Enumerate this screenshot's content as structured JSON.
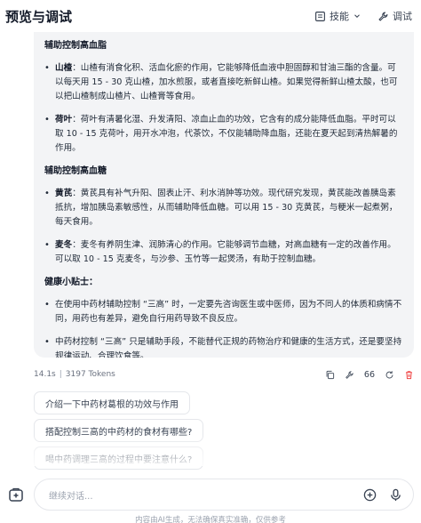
{
  "header": {
    "title": "预览与调试",
    "skills_label": "技能",
    "debug_label": "调试"
  },
  "message": {
    "sections": [
      {
        "title": "辅助控制高血脂",
        "items": [
          {
            "name": "山楂",
            "text": "：山楂有消食化积、活血化瘀的作用，它能够降低血液中胆固醇和甘油三酯的含量。可以每天用 15 - 30 克山楂，加水煎服，或者直接吃新鲜山楂。如果觉得新鲜山楂太酸，也可以把山楂制成山楂片、山楂膏等食用。"
          },
          {
            "name": "荷叶",
            "text": "：荷叶有清暑化湿、升发清阳、凉血止血的功效，它含有的成分能降低血脂。平时可以取 10 - 15 克荷叶，用开水冲泡，代茶饮，不仅能辅助降血脂，还能在夏天起到清热解暑的作用。"
          }
        ]
      },
      {
        "title": "辅助控制高血糖",
        "items": [
          {
            "name": "黄芪",
            "text": "：黄芪具有补气升阳、固表止汗、利水消肿等功效。现代研究发现，黄芪能改善胰岛素抵抗，增加胰岛素敏感性，从而辅助降低血糖。可以用 15 - 30 克黄芪，与粳米一起煮粥，每天食用。"
          },
          {
            "name": "麦冬",
            "text": "：麦冬有养阴生津、润肺清心的作用。它能够调节血糖，对高血糖有一定的改善作用。可以取 10 - 15 克麦冬，与沙参、玉竹等一起煲汤，有助于控制血糖。"
          }
        ]
      },
      {
        "title": "健康小贴士：",
        "items": [
          {
            "name": "",
            "text": "在使用中药材辅助控制 “三高” 时，一定要先咨询医生或中医师，因为不同人的体质和病情不同，用药也有差异，避免自行用药导致不良反应。"
          },
          {
            "name": "",
            "text": "中药材控制 “三高” 只是辅助手段，不能替代正规的药物治疗和健康的生活方式，还是要坚持规律运动、合理饮食等。"
          }
        ]
      }
    ]
  },
  "meta": {
    "time": "14.1s",
    "tokens": "3197 Tokens",
    "quote_count": "66"
  },
  "suggestions": [
    "介绍一下中药材葛根的功效与作用",
    "搭配控制三高的中药材的食材有哪些?",
    "喝中药调理三高的过程中要注意什么?"
  ],
  "input": {
    "placeholder": "继续对话..."
  },
  "footer": {
    "disclaimer": "内容由AI生成，无法确保真实准确，仅供参考"
  },
  "colors": {
    "bubble_bg": "#f3f4f6",
    "delete_icon": "#ef4444"
  },
  "icons": [
    "book-icon",
    "chevron-down-icon",
    "wrench-icon",
    "copy-icon",
    "tool-icon",
    "quote-icon",
    "refresh-icon",
    "delete-icon",
    "new-chat-icon",
    "add-icon",
    "mic-icon"
  ]
}
